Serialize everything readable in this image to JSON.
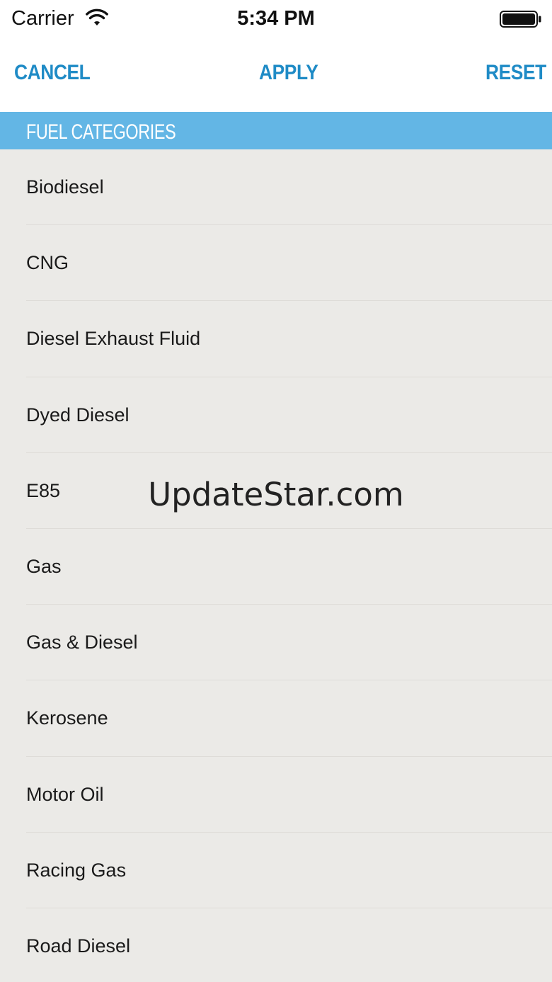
{
  "status_bar": {
    "carrier": "Carrier",
    "time": "5:34 PM"
  },
  "nav": {
    "cancel_label": "CANCEL",
    "apply_label": "APPLY",
    "reset_label": "RESET",
    "accent_color": "#1f8bc6"
  },
  "section": {
    "title": "FUEL CATEGORIES",
    "color": "#63b6e5"
  },
  "fuel_categories": [
    "Biodiesel",
    "CNG",
    "Diesel Exhaust Fluid",
    "Dyed Diesel",
    "E85",
    "Gas",
    "Gas & Diesel",
    "Kerosene",
    "Motor Oil",
    "Racing Gas",
    "Road Diesel"
  ],
  "watermark": "UpdateStar.com"
}
